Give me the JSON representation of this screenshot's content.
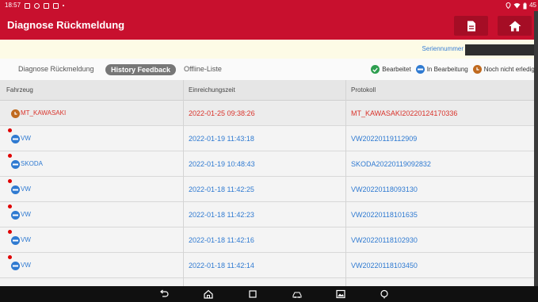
{
  "statusbar": {
    "time": "18:57",
    "right_text": "45"
  },
  "appbar": {
    "title": "Diagnose Rückmeldung",
    "report_icon": "document-icon",
    "home_icon": "home-icon"
  },
  "serial": {
    "label": "Seriennummer",
    "value": ""
  },
  "tabs": [
    {
      "label": "Diagnose Rückmeldung",
      "active": false
    },
    {
      "label": "History Feedback",
      "active": true
    },
    {
      "label": "Offline-Liste",
      "active": false
    }
  ],
  "legend": [
    {
      "label": "Bearbeitet",
      "color": "#2e9e4f",
      "icon": "check-icon"
    },
    {
      "label": "In Bearbeitung",
      "color": "#2f7ad1",
      "icon": "in-progress-icon"
    },
    {
      "label": "Noch nicht erledigt",
      "color": "#c06a1f",
      "icon": "clock-icon"
    }
  ],
  "table": {
    "headers": [
      "Fahrzeug",
      "Einreichungszeit",
      "Protokoll"
    ],
    "rows": [
      {
        "vehicle": "MT_KAWASAKI",
        "time": "2022-01-25 09:38:26",
        "protocol": "MT_KAWASAKI20220124170336",
        "status": "pending",
        "new": false
      },
      {
        "vehicle": "VW",
        "time": "2022-01-19 11:43:18",
        "protocol": "VW20220119112909",
        "status": "progress",
        "new": true
      },
      {
        "vehicle": "SKODA",
        "time": "2022-01-19 10:48:43",
        "protocol": "SKODA20220119092832",
        "status": "progress",
        "new": true
      },
      {
        "vehicle": "VW",
        "time": "2022-01-18 11:42:25",
        "protocol": "VW20220118093130",
        "status": "progress",
        "new": true
      },
      {
        "vehicle": "VW",
        "time": "2022-01-18 11:42:23",
        "protocol": "VW20220118101635",
        "status": "progress",
        "new": true
      },
      {
        "vehicle": "VW",
        "time": "2022-01-18 11:42:16",
        "protocol": "VW20220118102930",
        "status": "progress",
        "new": true
      },
      {
        "vehicle": "VW",
        "time": "2022-01-18 11:42:14",
        "protocol": "VW20220118103450",
        "status": "progress",
        "new": true
      }
    ]
  },
  "colors": {
    "brand": "#c8102e",
    "pending": "#c06a1f",
    "progress": "#2f7ad1",
    "done": "#2e9e4f",
    "red_text": "#d9332b",
    "blue_text": "#2f7ad1"
  },
  "navbar": {
    "icons": [
      "back-icon",
      "home-icon",
      "recents-icon",
      "vci-icon",
      "screenshot-icon",
      "assistant-icon"
    ]
  }
}
